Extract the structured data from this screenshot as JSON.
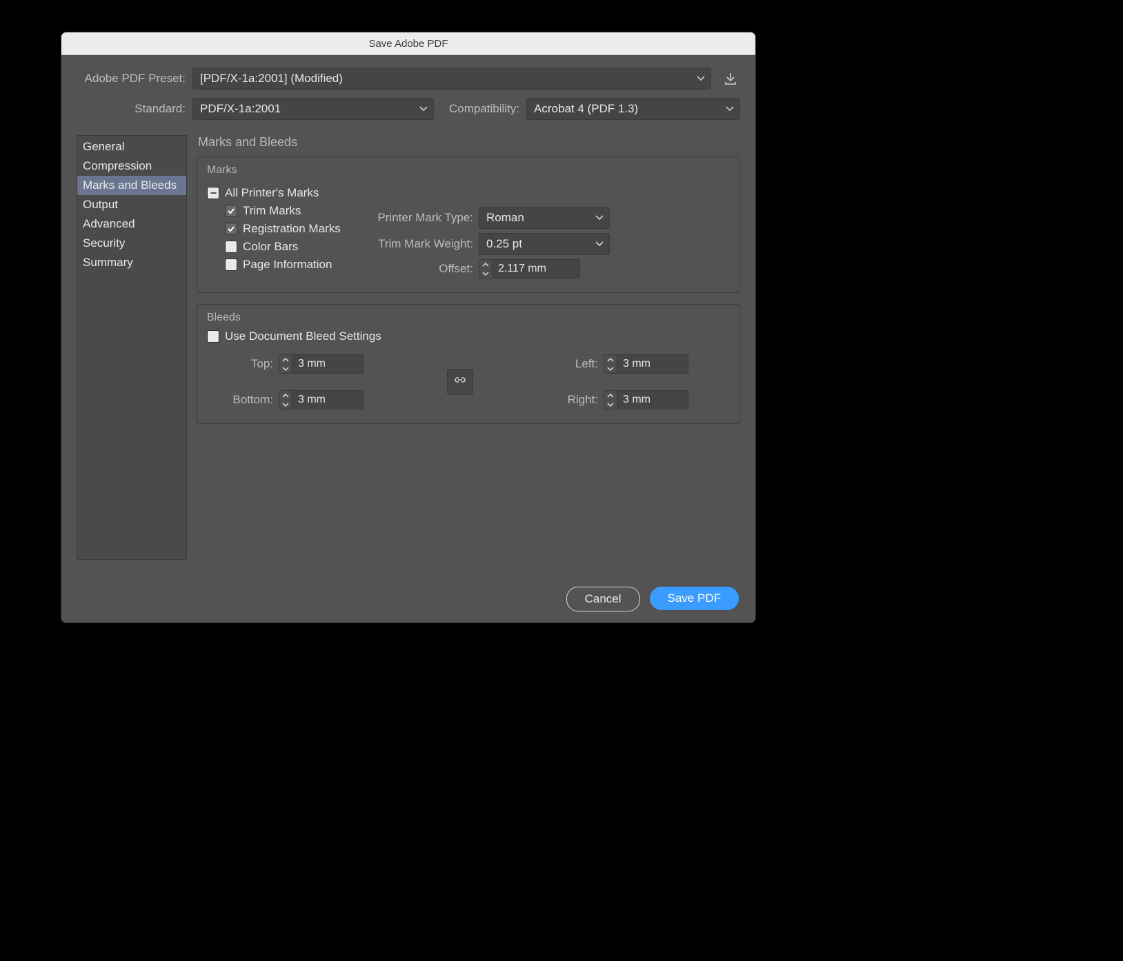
{
  "title": "Save Adobe PDF",
  "preset": {
    "label": "Adobe PDF Preset:",
    "value": "[PDF/X-1a:2001] (Modified)"
  },
  "standard": {
    "label": "Standard:",
    "value": "PDF/X-1a:2001"
  },
  "compatibility": {
    "label": "Compatibility:",
    "value": "Acrobat 4 (PDF 1.3)"
  },
  "sidebar": {
    "items": [
      {
        "label": "General"
      },
      {
        "label": "Compression"
      },
      {
        "label": "Marks and Bleeds"
      },
      {
        "label": "Output"
      },
      {
        "label": "Advanced"
      },
      {
        "label": "Security"
      },
      {
        "label": "Summary"
      }
    ],
    "selected_index": 2
  },
  "panel_title": "Marks and Bleeds",
  "marks": {
    "legend": "Marks",
    "all_label": "All Printer's Marks",
    "all_state": "mixed",
    "trim": {
      "label": "Trim Marks",
      "checked": true
    },
    "registration": {
      "label": "Registration Marks",
      "checked": true
    },
    "colorbars": {
      "label": "Color Bars",
      "checked": false
    },
    "pageinfo": {
      "label": "Page Information",
      "checked": false
    },
    "printer_mark_type": {
      "label": "Printer Mark Type:",
      "value": "Roman"
    },
    "trim_mark_weight": {
      "label": "Trim Mark Weight:",
      "value": "0.25 pt"
    },
    "offset": {
      "label": "Offset:",
      "value": "2.117 mm"
    }
  },
  "bleeds": {
    "legend": "Bleeds",
    "use_doc": {
      "label": "Use Document Bleed Settings",
      "checked": false
    },
    "top": {
      "label": "Top:",
      "value": "3 mm"
    },
    "bottom": {
      "label": "Bottom:",
      "value": "3 mm"
    },
    "left": {
      "label": "Left:",
      "value": "3 mm"
    },
    "right": {
      "label": "Right:",
      "value": "3 mm"
    }
  },
  "buttons": {
    "cancel": "Cancel",
    "save": "Save PDF"
  }
}
